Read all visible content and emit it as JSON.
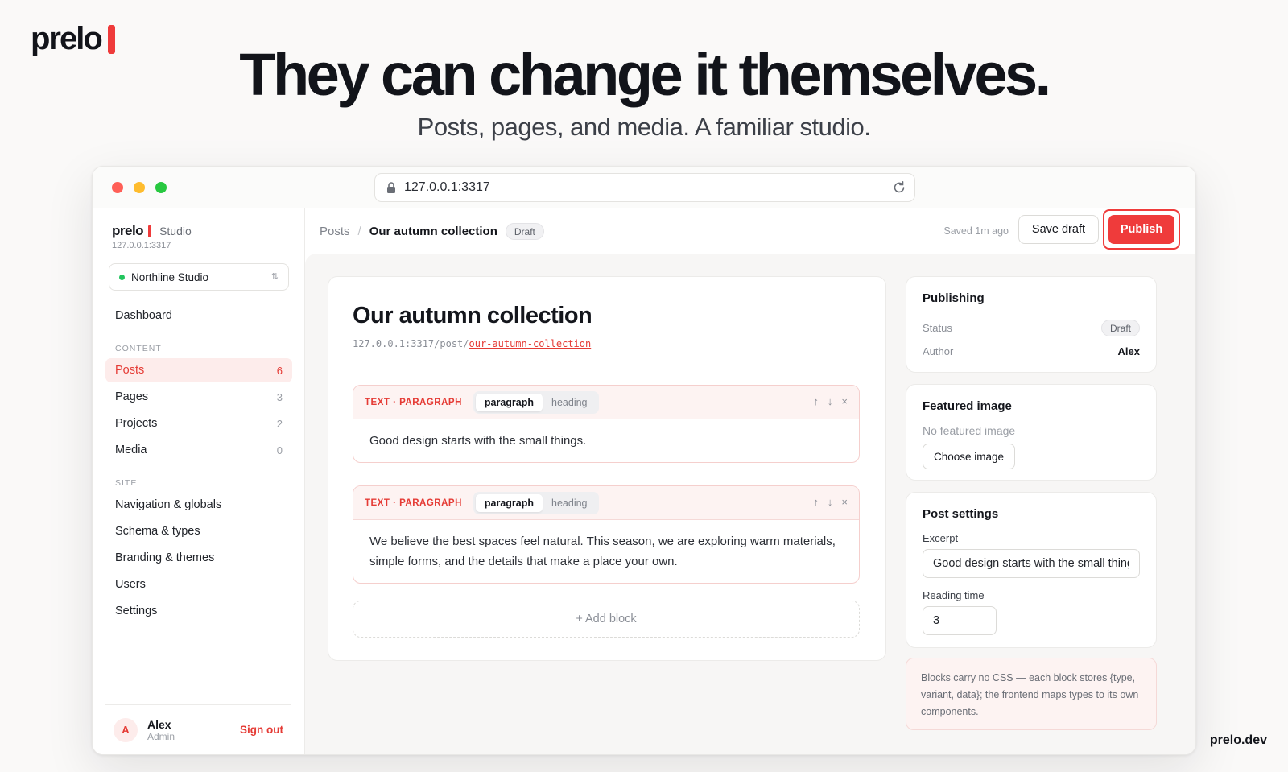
{
  "brand": {
    "name": "prelo",
    "accent": "#ef3b3b"
  },
  "hero": {
    "title": "They can change it themselves.",
    "subtitle": "Posts, pages, and media. A familiar studio."
  },
  "footer": {
    "domain": "prelo.dev"
  },
  "browser": {
    "url": "127.0.0.1:3317",
    "lock_icon": "lock-icon",
    "reload_icon": "reload-icon"
  },
  "sidebar": {
    "brand_name": "prelo",
    "brand_suffix": "Studio",
    "host": "127.0.0.1:3317",
    "workspace": "Northline Studio",
    "top_item": "Dashboard",
    "content_section": "CONTENT",
    "content_items": [
      {
        "label": "Posts",
        "count": "6"
      },
      {
        "label": "Pages",
        "count": "3"
      },
      {
        "label": "Projects",
        "count": "2"
      },
      {
        "label": "Media",
        "count": "0"
      }
    ],
    "site_section": "SITE",
    "site_items": [
      {
        "label": "Navigation & globals"
      },
      {
        "label": "Schema & types"
      },
      {
        "label": "Branding & themes"
      },
      {
        "label": "Users"
      },
      {
        "label": "Settings"
      }
    ],
    "user": {
      "initial": "A",
      "name": "Alex",
      "role": "Admin",
      "signout": "Sign out"
    }
  },
  "topbar": {
    "crumb_root": "Posts",
    "crumb_sep": "/",
    "crumb_current": "Our autumn collection",
    "status_badge": "Draft",
    "saved": "Saved 1m ago",
    "save_draft": "Save draft",
    "publish": "Publish"
  },
  "editor": {
    "title": "Our autumn collection",
    "url_prefix": "127.0.0.1:3317/post/",
    "slug": "our-autumn-collection",
    "blocks": [
      {
        "type": "TEXT · PARAGRAPH",
        "variant_on": "paragraph",
        "variant_off": "heading",
        "text": "Good design starts with the small things."
      },
      {
        "type": "TEXT · PARAGRAPH",
        "variant_on": "paragraph",
        "variant_off": "heading",
        "text": "We believe the best spaces feel natural. This season, we are exploring warm materials, simple forms, and the details that make a place your own."
      }
    ],
    "block_actions": {
      "up": "↑",
      "down": "↓",
      "remove": "×"
    },
    "add_block": "+ Add block"
  },
  "publishing": {
    "title": "Publishing",
    "status_label": "Status",
    "status_value": "Draft",
    "author_label": "Author",
    "author_value": "Alex"
  },
  "featured": {
    "title": "Featured image",
    "empty": "No featured image",
    "choose": "Choose image"
  },
  "post_settings": {
    "title": "Post settings",
    "excerpt_label": "Excerpt",
    "excerpt_value": "Good design starts with the small things.",
    "reading_label": "Reading time",
    "reading_value": "3"
  },
  "note": "Blocks carry no CSS — each block stores {type, variant, data}; the frontend maps types to its own components."
}
